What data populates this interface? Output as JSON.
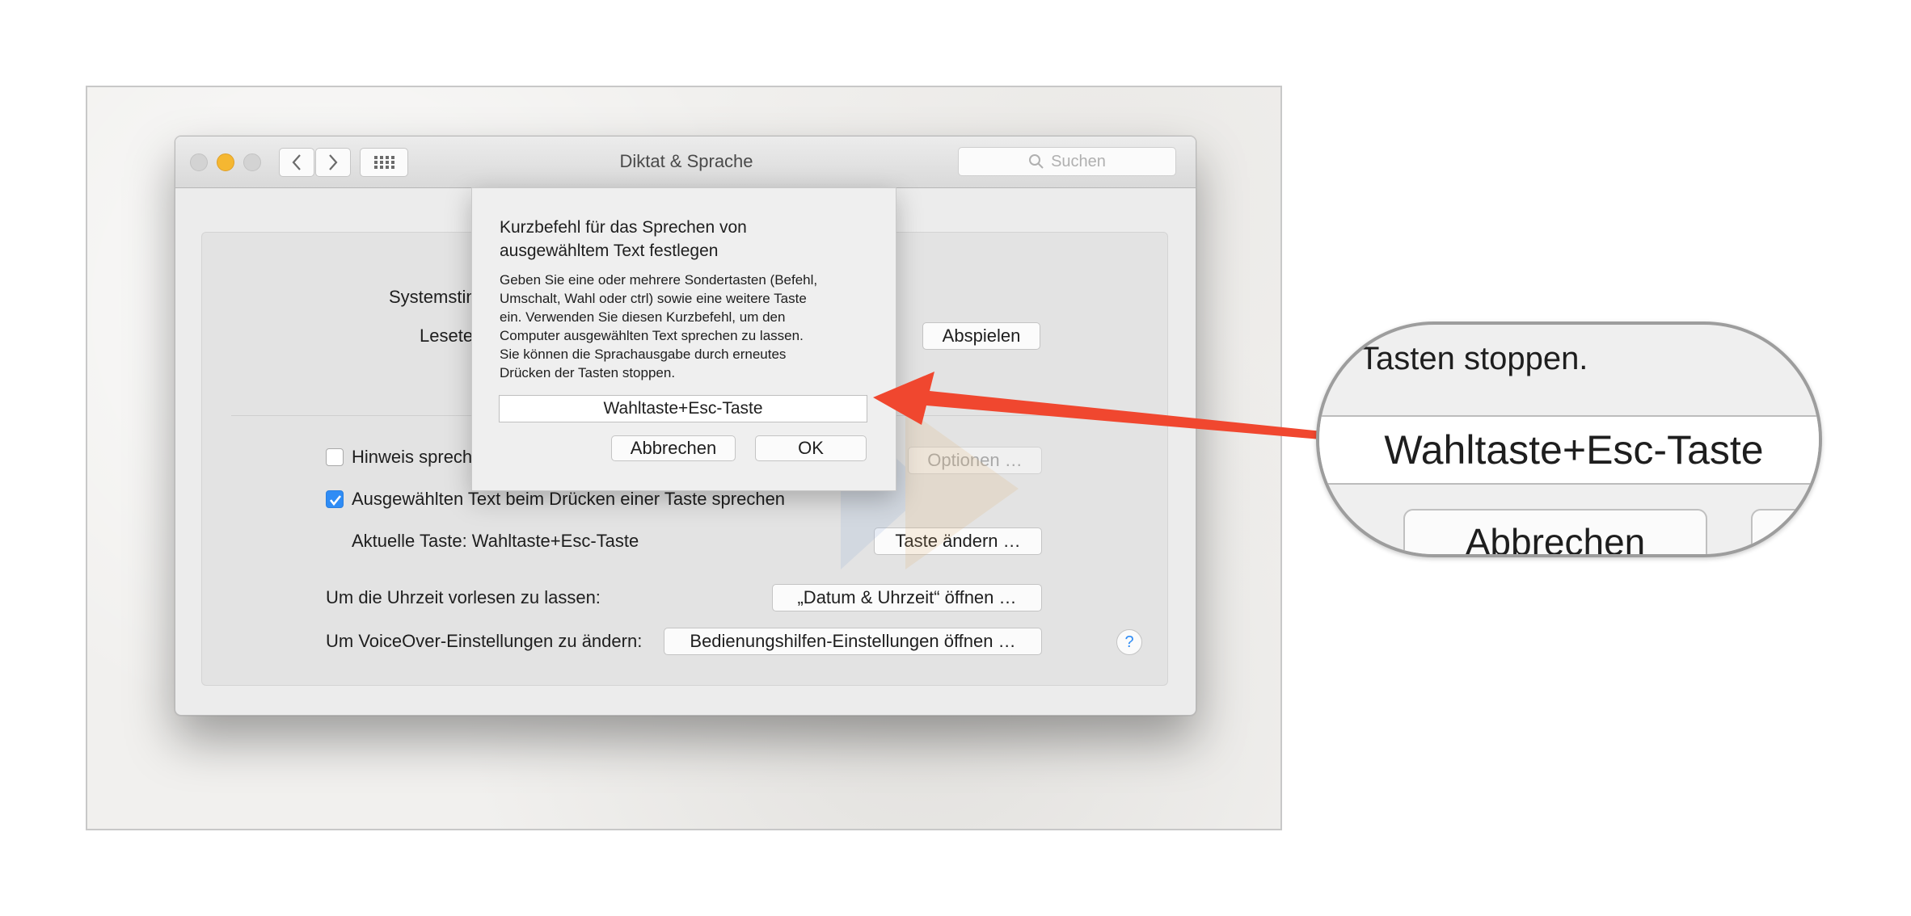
{
  "window": {
    "title": "Diktat & Sprache",
    "search_placeholder": "Suchen"
  },
  "panel": {
    "systemstimme_label": "Systemstimme:",
    "lesetempo_label": "Lesetempo:",
    "play_button": "Abspielen",
    "hinweis_checkbox": {
      "label": "Hinweis sprechen, wenn eine App Aufmerksamkeit benötigt",
      "checked": false
    },
    "optionen_button": "Optionen …",
    "ausgewaehlt_checkbox": {
      "label": "Ausgewählten Text beim Drücken einer Taste sprechen",
      "checked": true
    },
    "aktuelle_taste_label": "Aktuelle Taste: Wahltaste+Esc-Taste",
    "taste_aendern_button": "Taste ändern …",
    "uhrzeit_label": "Um die Uhrzeit vorlesen zu lassen:",
    "datum_button": "„Datum & Uhrzeit“ öffnen …",
    "voiceover_label": "Um VoiceOver-Einstellungen zu ändern:",
    "bedienungshilfen_button": "Bedienungshilfen-Einstellungen öffnen …",
    "help_button": "?"
  },
  "sheet": {
    "title_line1": "Kurzbefehl für das Sprechen von",
    "title_line2": "ausgewähltem Text festlegen",
    "body_lines": [
      "Geben Sie eine oder mehrere Sondertasten (Befehl,",
      "Umschalt, Wahl oder ctrl) sowie eine weitere Taste",
      "ein. Verwenden Sie diesen Kurzbefehl, um den",
      "Computer ausgewählten Text sprechen zu lassen.",
      "Sie können die Sprachausgabe durch erneutes",
      "Drücken der Tasten stoppen."
    ],
    "shortcut_value": "Wahltaste+Esc-Taste",
    "cancel_button": "Abbrechen",
    "ok_button": "OK"
  },
  "lens": {
    "text_top": "Tasten stoppen.",
    "field_value": "Wahltaste+Esc-Taste",
    "button_label": "Abbrechen"
  },
  "colors": {
    "close": "#d3d3d3",
    "minimize": "#f5b731",
    "zoom": "#d3d3d3",
    "checkbox_accent": "#2f8cf5",
    "arrow": "#f0472f"
  },
  "icons": [
    "back-chevron-icon",
    "forward-chevron-icon",
    "grid-icon",
    "search-icon",
    "checkmark-icon",
    "help-icon"
  ]
}
